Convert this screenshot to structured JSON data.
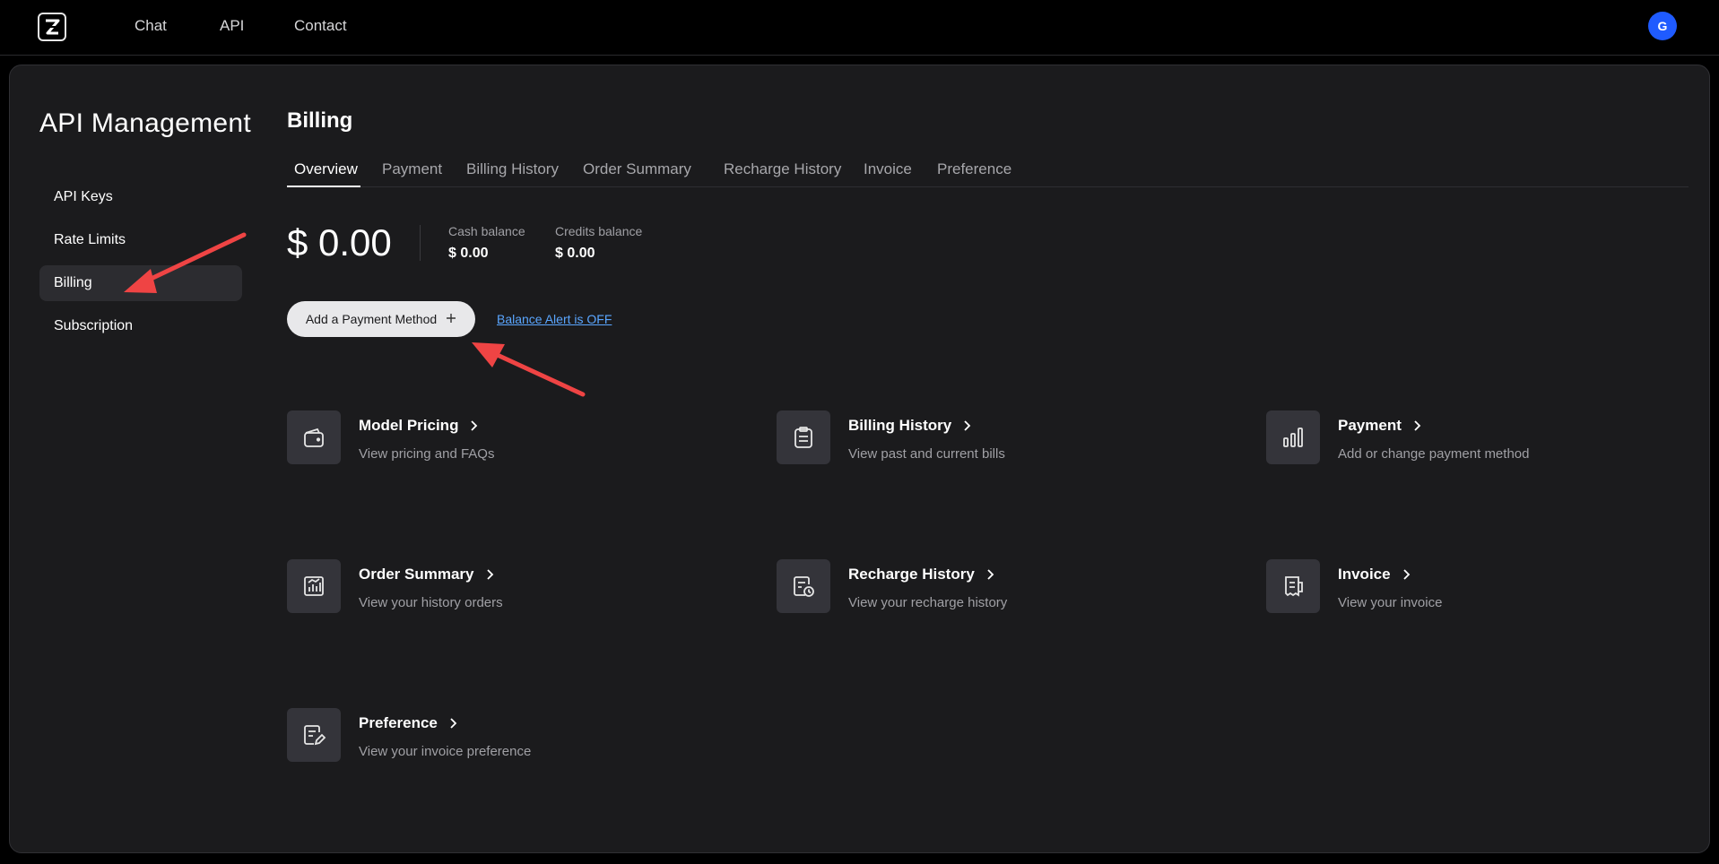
{
  "nav": {
    "logo_icon": "z-logo-icon",
    "links": [
      "Chat",
      "API",
      "Contact"
    ],
    "avatar_letter": "G",
    "avatar_color": "#1f5bff"
  },
  "sidebar": {
    "title": "API Management",
    "items": [
      {
        "label": "API Keys",
        "active": false
      },
      {
        "label": "Rate Limits",
        "active": false
      },
      {
        "label": "Billing",
        "active": true
      },
      {
        "label": "Subscription",
        "active": false
      }
    ]
  },
  "main": {
    "title": "Billing",
    "tabs": [
      {
        "label": "Overview",
        "active": true
      },
      {
        "label": "Payment",
        "active": false
      },
      {
        "label": "Billing History",
        "active": false
      },
      {
        "label": "Order Summary",
        "active": false
      },
      {
        "label": "Recharge History",
        "active": false
      },
      {
        "label": "Invoice",
        "active": false
      },
      {
        "label": "Preference",
        "active": false
      }
    ],
    "balance": {
      "total": "$ 0.00",
      "cash_label": "Cash balance",
      "cash_value": "$ 0.00",
      "credits_label": "Credits balance",
      "credits_value": "$ 0.00"
    },
    "add_payment_label": "Add a Payment Method",
    "add_payment_icon": "plus-icon",
    "balance_alert_label": "Balance Alert is OFF",
    "cards": [
      {
        "title": "Model Pricing",
        "desc": "View pricing and FAQs",
        "icon": "wallet-icon"
      },
      {
        "title": "Billing History",
        "desc": "View past and current bills",
        "icon": "clipboard-icon"
      },
      {
        "title": "Payment",
        "desc": "Add or change payment method",
        "icon": "bar-chart-icon"
      },
      {
        "title": "Order Summary",
        "desc": "View your history orders",
        "icon": "chart-box-icon"
      },
      {
        "title": "Recharge History",
        "desc": "View your recharge history",
        "icon": "history-list-icon"
      },
      {
        "title": "Invoice",
        "desc": "View your invoice",
        "icon": "receipt-icon"
      },
      {
        "title": "Preference",
        "desc": "View your invoice preference",
        "icon": "edit-document-icon"
      }
    ]
  },
  "annotations": {
    "arrow_color": "#ef4444"
  }
}
